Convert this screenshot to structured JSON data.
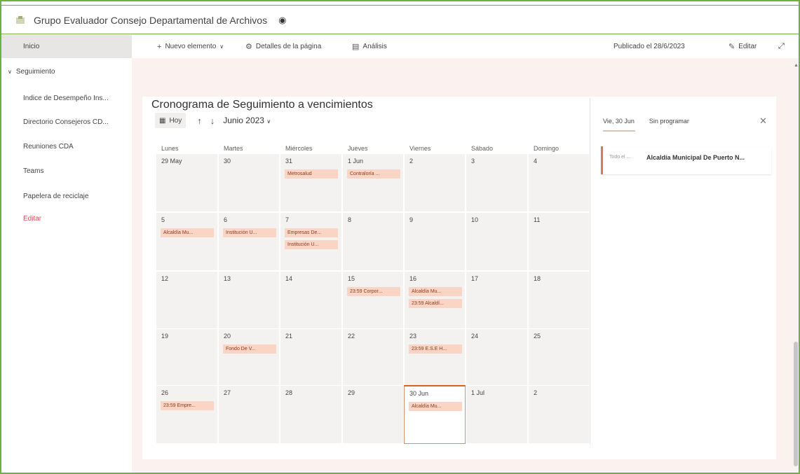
{
  "site": {
    "title": "Grupo Evaluador Consejo Departamental de Archivos"
  },
  "nav": {
    "home": "Inicio",
    "group": "Seguimiento",
    "items": [
      "Indice de Desempeño Ins...",
      "Directorio Consejeros CD...",
      "Reuniones CDA",
      "Teams",
      "Papelera de reciclaje"
    ],
    "edit": "Editar"
  },
  "commandbar": {
    "new": "Nuevo elemento",
    "details": "Detalles de la página",
    "analytics": "Análisis",
    "published": "Publicado el 28/6/2023",
    "edit": "Editar"
  },
  "webpart": {
    "title": "Cronograma de Seguimiento a vencimientos"
  },
  "calendar": {
    "today_label": "Hoy",
    "month": "Junio 2023",
    "weekdays": [
      "Lunes",
      "Martes",
      "Miércoles",
      "Jueves",
      "Viernes",
      "Sábado",
      "Domingo"
    ],
    "weeks": [
      [
        {
          "day": "29 May",
          "events": []
        },
        {
          "day": "30",
          "events": []
        },
        {
          "day": "31",
          "events": [
            "Metrosalud"
          ]
        },
        {
          "day": "1 Jun",
          "events": [
            "Contraloría ..."
          ]
        },
        {
          "day": "2",
          "events": []
        },
        {
          "day": "3",
          "events": []
        },
        {
          "day": "4",
          "events": []
        }
      ],
      [
        {
          "day": "5",
          "events": [
            "Alcaldía Mu..."
          ]
        },
        {
          "day": "6",
          "events": [
            "Institución U..."
          ]
        },
        {
          "day": "7",
          "events": [
            "Empresas De...",
            "Institución U..."
          ]
        },
        {
          "day": "8",
          "events": []
        },
        {
          "day": "9",
          "events": []
        },
        {
          "day": "10",
          "events": []
        },
        {
          "day": "11",
          "events": []
        }
      ],
      [
        {
          "day": "12",
          "events": []
        },
        {
          "day": "13",
          "events": []
        },
        {
          "day": "14",
          "events": []
        },
        {
          "day": "15",
          "events": [
            "23:59 Corpor..."
          ]
        },
        {
          "day": "16",
          "events": [
            "Alcaldía Mu...",
            "23:59 Alcaldí..."
          ]
        },
        {
          "day": "17",
          "events": []
        },
        {
          "day": "18",
          "events": []
        }
      ],
      [
        {
          "day": "19",
          "events": []
        },
        {
          "day": "20",
          "events": [
            "Fondo De V..."
          ]
        },
        {
          "day": "21",
          "events": []
        },
        {
          "day": "22",
          "events": []
        },
        {
          "day": "23",
          "events": [
            "23:59 E.S.E H..."
          ]
        },
        {
          "day": "24",
          "events": []
        },
        {
          "day": "25",
          "events": []
        }
      ],
      [
        {
          "day": "26",
          "events": [
            "23:59 Empre..."
          ]
        },
        {
          "day": "27",
          "events": []
        },
        {
          "day": "28",
          "events": []
        },
        {
          "day": "29",
          "events": []
        },
        {
          "day": "30 Jun",
          "events": [
            "Alcaldía Mu..."
          ],
          "today": true
        },
        {
          "day": "1 Jul",
          "events": []
        },
        {
          "day": "2",
          "events": []
        }
      ]
    ]
  },
  "panel": {
    "tab_day": "Vie, 30 Jun",
    "tab_unscheduled": "Sin programar",
    "item_time": "Todo el ...",
    "item_title": "Alcaldía Municipal De Puerto N..."
  },
  "colors": {
    "accent": "#d4622e",
    "event_bg": "#fad4c5",
    "frame": "#6fb13c",
    "page_bg": "#fbf2ef"
  }
}
